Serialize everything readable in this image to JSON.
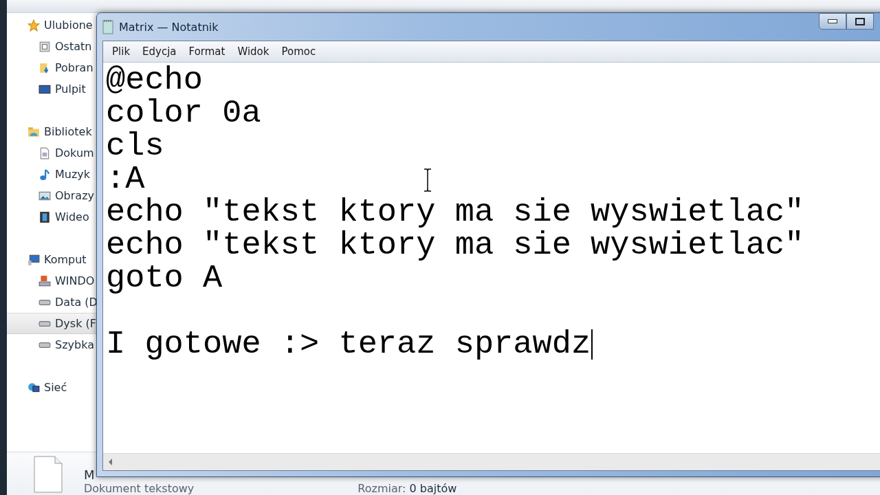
{
  "explorer": {
    "sidebar": [
      {
        "label": "Ulubione",
        "children": [
          {
            "label": "Ostatn",
            "selected": false
          },
          {
            "label": "Pobran",
            "selected": false
          },
          {
            "label": "Pulpit",
            "selected": false
          }
        ]
      },
      {
        "label": "Bibliotek",
        "children": [
          {
            "label": "Dokum",
            "selected": false
          },
          {
            "label": "Muzyk",
            "selected": false
          },
          {
            "label": "Obrazy",
            "selected": false
          },
          {
            "label": "Wideo",
            "selected": false
          }
        ]
      },
      {
        "label": "Komput",
        "children": [
          {
            "label": "WINDO",
            "selected": false
          },
          {
            "label": "Data (D",
            "selected": false
          },
          {
            "label": "Dysk (F",
            "selected": true
          },
          {
            "label": "Szybka",
            "selected": false
          }
        ]
      },
      {
        "label": "Sieć"
      }
    ],
    "details": {
      "name": "M",
      "type": "Dokument tekstowy",
      "size": "Rozmiar: **0 bajtów**"
    }
  },
  "notepad": {
    "title": "Matrix — Notatnik",
    "menu": [
      "Plik",
      "Edycja",
      "Format",
      "Widok",
      "Pomoc"
    ],
    "lines": [
      {
        "kind": "text",
        "text": "@echo",
        "cursor": false
      },
      {
        "kind": "text",
        "text": "color 0a",
        "cursor": false
      },
      {
        "kind": "text",
        "text": "cls",
        "cursor": false
      },
      {
        "kind": "text",
        "text": ":A",
        "cursor": false
      },
      {
        "kind": "text",
        "text": "echo \"tekst ktory ma sie wyswietlac\"",
        "cursor": false
      },
      {
        "kind": "text",
        "text": "echo \"tekst ktory ma sie wyswietlac\"",
        "cursor": false
      },
      {
        "kind": "text",
        "text": "goto A",
        "cursor": false
      },
      {
        "kind": "blank"
      },
      {
        "kind": "text",
        "text": "I gotowe :> teraz sprawdz",
        "cursor": true
      }
    ]
  }
}
